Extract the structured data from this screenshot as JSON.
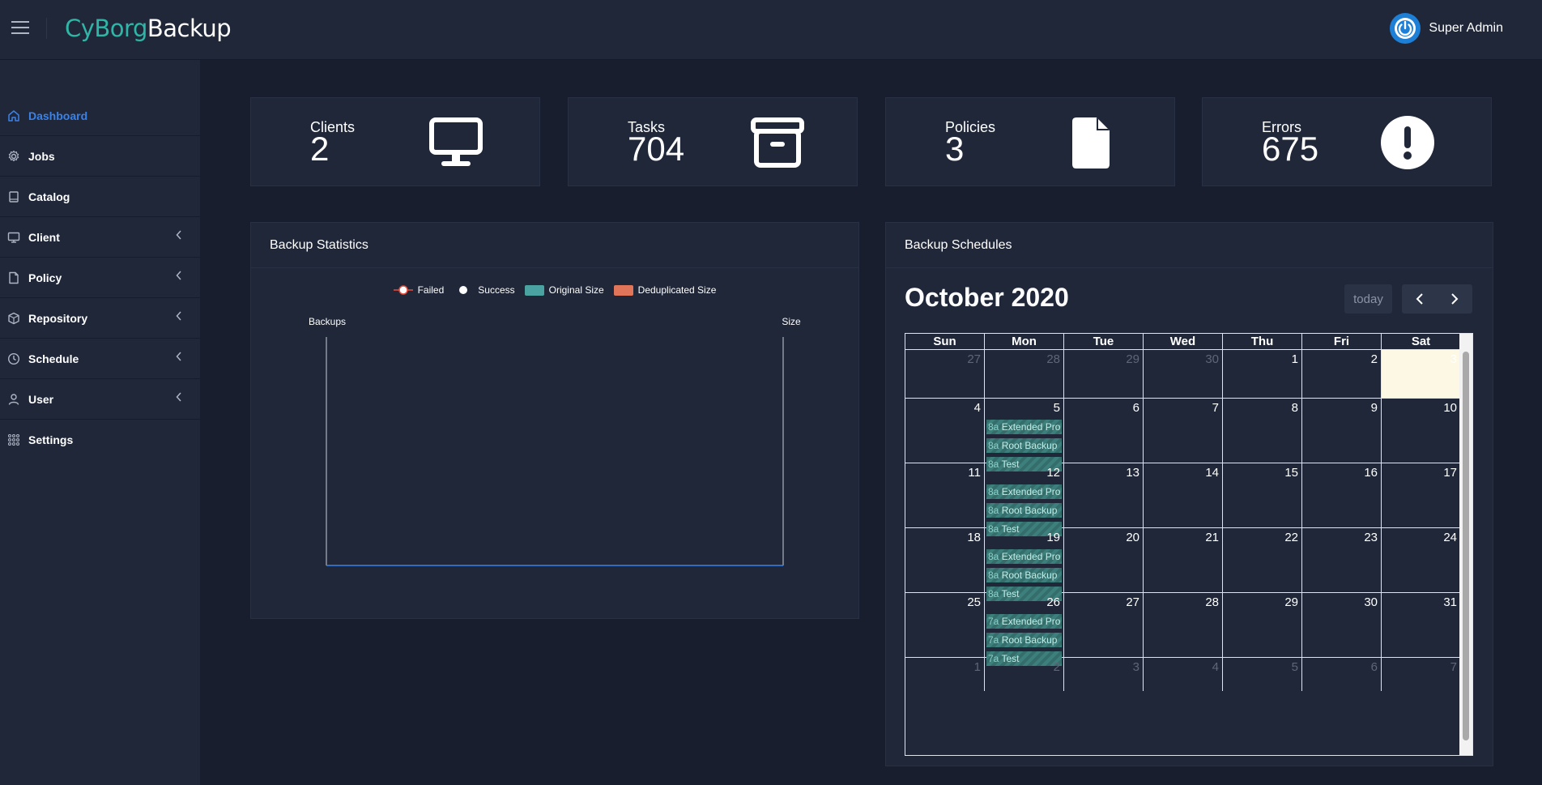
{
  "app": {
    "brand_part1": "CyBorg",
    "brand_part2": "Backup",
    "user_name": "Super Admin"
  },
  "sidebar": {
    "items": [
      {
        "label": "Dashboard",
        "icon": "home-icon",
        "active": true,
        "has_chevron": false
      },
      {
        "label": "Jobs",
        "icon": "gear-icon",
        "active": false,
        "has_chevron": false
      },
      {
        "label": "Catalog",
        "icon": "book-icon",
        "active": false,
        "has_chevron": false
      },
      {
        "label": "Client",
        "icon": "monitor-icon",
        "active": false,
        "has_chevron": true
      },
      {
        "label": "Policy",
        "icon": "file-icon",
        "active": false,
        "has_chevron": true
      },
      {
        "label": "Repository",
        "icon": "box-icon",
        "active": false,
        "has_chevron": true
      },
      {
        "label": "Schedule",
        "icon": "clock-icon",
        "active": false,
        "has_chevron": true
      },
      {
        "label": "User",
        "icon": "user-icon",
        "active": false,
        "has_chevron": true
      },
      {
        "label": "Settings",
        "icon": "grid-icon",
        "active": false,
        "has_chevron": false
      }
    ]
  },
  "stats": {
    "clients": {
      "label": "Clients",
      "value": "2",
      "icon": "monitor-icon"
    },
    "tasks": {
      "label": "Tasks",
      "value": "704",
      "icon": "archive-icon"
    },
    "policies": {
      "label": "Policies",
      "value": "3",
      "icon": "file-icon"
    },
    "errors": {
      "label": "Errors",
      "value": "675",
      "icon": "exclamation-icon"
    }
  },
  "backup_statistics": {
    "title": "Backup Statistics"
  },
  "chart_data": {
    "type": "line",
    "legend": [
      {
        "name": "Failed",
        "marker": "circle",
        "color": "#ffffff",
        "border": "#e74c3c"
      },
      {
        "name": "Success",
        "marker": "circle",
        "color": "#ffffff"
      },
      {
        "name": "Original Size",
        "marker": "box",
        "color": "#4aa3a0"
      },
      {
        "name": "Deduplicated Size",
        "marker": "box",
        "color": "#e0755a"
      }
    ],
    "left_axis_label": "Backups",
    "right_axis_label": "Size",
    "series": [],
    "legend_position": "top",
    "grid": false,
    "axis_color": "#3b82e8"
  },
  "schedules": {
    "title": "Backup Schedules",
    "calendar_title": "October 2020",
    "today_label": "today",
    "day_headers": [
      "Sun",
      "Mon",
      "Tue",
      "Wed",
      "Thu",
      "Fri",
      "Sat"
    ],
    "weeks": [
      {
        "days": [
          {
            "n": "27",
            "other": true
          },
          {
            "n": "28",
            "other": true
          },
          {
            "n": "29",
            "other": true
          },
          {
            "n": "30",
            "other": true
          },
          {
            "n": "1"
          },
          {
            "n": "2"
          },
          {
            "n": "3",
            "today": true
          }
        ]
      },
      {
        "days": [
          {
            "n": "4"
          },
          {
            "n": "5",
            "events": [
              {
                "time": "8a",
                "title": "Extended Pro"
              },
              {
                "time": "8a",
                "title": "Root Backup"
              },
              {
                "time": "8a",
                "title": "Test"
              }
            ]
          },
          {
            "n": "6"
          },
          {
            "n": "7"
          },
          {
            "n": "8"
          },
          {
            "n": "9"
          },
          {
            "n": "10"
          }
        ]
      },
      {
        "days": [
          {
            "n": "11"
          },
          {
            "n": "12",
            "events": [
              {
                "time": "8a",
                "title": "Extended Pro"
              },
              {
                "time": "8a",
                "title": "Root Backup"
              },
              {
                "time": "8a",
                "title": "Test"
              }
            ]
          },
          {
            "n": "13"
          },
          {
            "n": "14"
          },
          {
            "n": "15"
          },
          {
            "n": "16"
          },
          {
            "n": "17"
          }
        ]
      },
      {
        "days": [
          {
            "n": "18"
          },
          {
            "n": "19",
            "events": [
              {
                "time": "8a",
                "title": "Extended Pro"
              },
              {
                "time": "8a",
                "title": "Root Backup"
              },
              {
                "time": "8a",
                "title": "Test"
              }
            ]
          },
          {
            "n": "20"
          },
          {
            "n": "21"
          },
          {
            "n": "22"
          },
          {
            "n": "23"
          },
          {
            "n": "24"
          }
        ]
      },
      {
        "days": [
          {
            "n": "25"
          },
          {
            "n": "26",
            "events": [
              {
                "time": "7a",
                "title": "Extended Pro"
              },
              {
                "time": "7a",
                "title": "Root Backup"
              },
              {
                "time": "7a",
                "title": "Test"
              }
            ]
          },
          {
            "n": "27"
          },
          {
            "n": "28"
          },
          {
            "n": "29"
          },
          {
            "n": "30"
          },
          {
            "n": "31"
          }
        ]
      },
      {
        "days": [
          {
            "n": "1",
            "other": true
          },
          {
            "n": "2",
            "other": true
          },
          {
            "n": "3",
            "other": true
          },
          {
            "n": "4",
            "other": true
          },
          {
            "n": "5",
            "other": true
          },
          {
            "n": "6",
            "other": true
          },
          {
            "n": "7",
            "other": true
          }
        ]
      }
    ]
  },
  "colors": {
    "brand_accent": "#2eb6a6",
    "active_nav": "#3b82e8",
    "background": "#181e2e",
    "panel": "#1f2739",
    "event": "#3c7f7c",
    "today_cell": "#fcf8e3"
  }
}
